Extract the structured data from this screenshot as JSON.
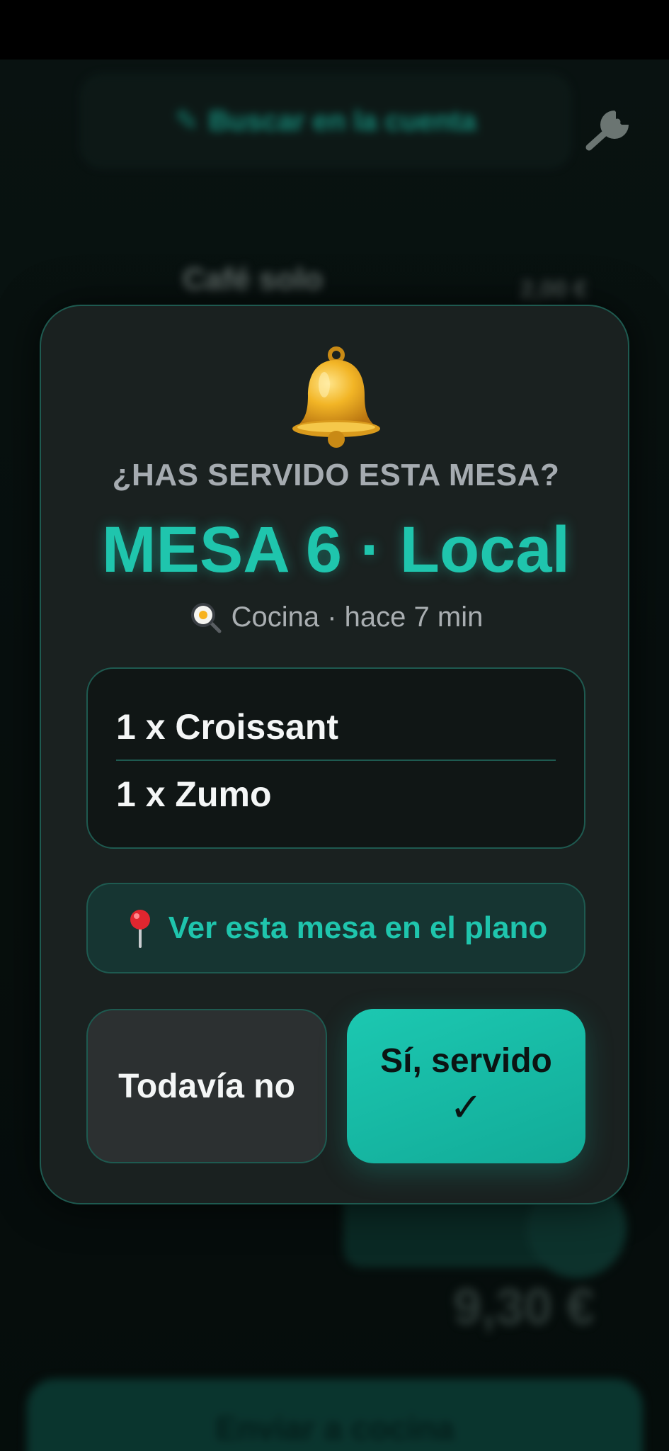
{
  "background": {
    "search_label": "Buscar en la cuenta",
    "row_name": "Café solo",
    "row_price": "2,00 €",
    "total": "9,30 €",
    "bottom_button": "Enviar a cocina"
  },
  "modal": {
    "question": "¿HAS SERVIDO ESTA MESA?",
    "table_title": "MESA 6 · Local",
    "meta": "Cocina · hace 7 min",
    "items": [
      "1 x Croissant",
      "1 x Zumo"
    ],
    "map_button": "Ver esta mesa en el plano",
    "no_button": "Todavía no",
    "yes_button": "Sí, servido",
    "yes_check": "✓"
  },
  "icons": {
    "bell": "bell-icon",
    "cooking": "fried-egg-pan-icon",
    "pin": "pushpin-icon",
    "wrench": "wrench-icon",
    "search": "search-icon"
  },
  "colors": {
    "accent": "#1fc5ad",
    "modal_bg": "#1a2120",
    "border": "#1e5a50"
  }
}
